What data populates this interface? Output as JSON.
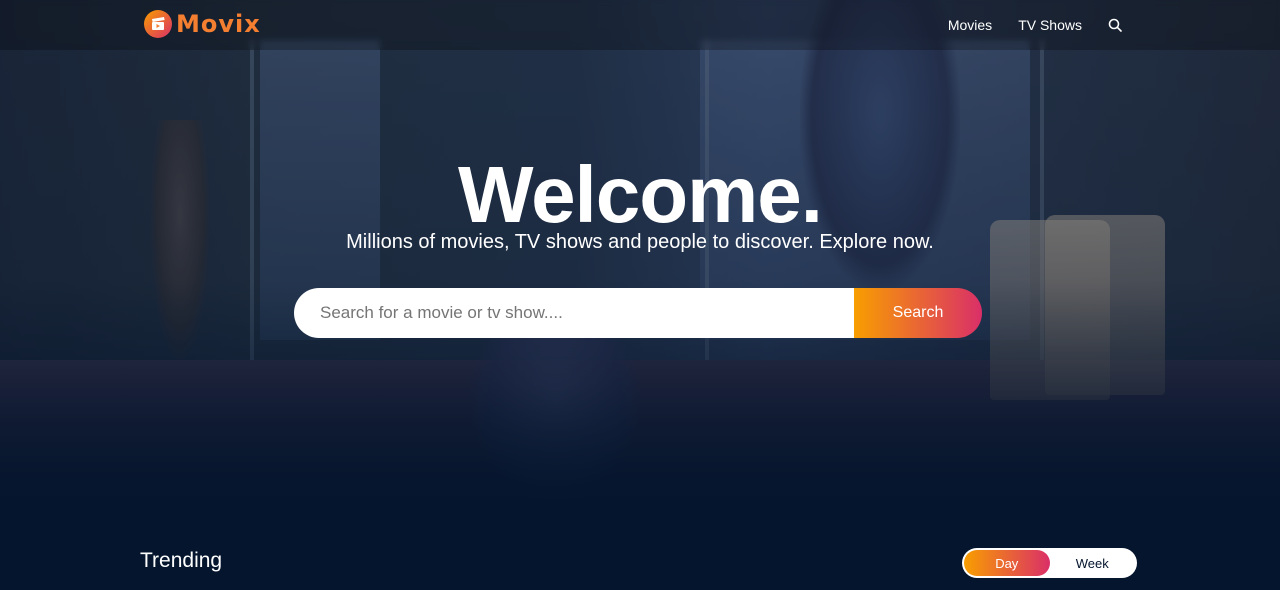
{
  "brand": {
    "name": "Movix",
    "accent_start": "#f89e00",
    "accent_end": "#da2f68",
    "logo_icon": "film-clapper-icon"
  },
  "nav": {
    "items": [
      {
        "label": "Movies"
      },
      {
        "label": "TV Shows"
      }
    ],
    "search_icon": "search-icon"
  },
  "hero": {
    "title": "Welcome.",
    "subtitle": "Millions of movies, TV shows and people to discover. Explore now.",
    "search": {
      "placeholder": "Search for a movie or tv show....",
      "value": "",
      "button_label": "Search"
    }
  },
  "trending": {
    "title": "Trending",
    "tabs": [
      {
        "label": "Day",
        "active": true
      },
      {
        "label": "Week",
        "active": false
      }
    ]
  },
  "colors": {
    "page_background": "#04152d",
    "text": "#ffffff"
  }
}
